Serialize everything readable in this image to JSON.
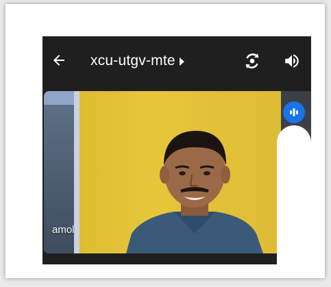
{
  "header": {
    "meeting_code": "xcu-utgv-mte",
    "back_icon": "arrow-left-icon",
    "switch_camera_icon": "switch-camera-icon",
    "audio_icon": "speaker-icon"
  },
  "participant": {
    "name": "amol",
    "speaking_icon": "audio-level-icon"
  },
  "colors": {
    "topbar": "#1f1f1f",
    "accent": "#1a73e8",
    "wall": "#e3c037"
  }
}
